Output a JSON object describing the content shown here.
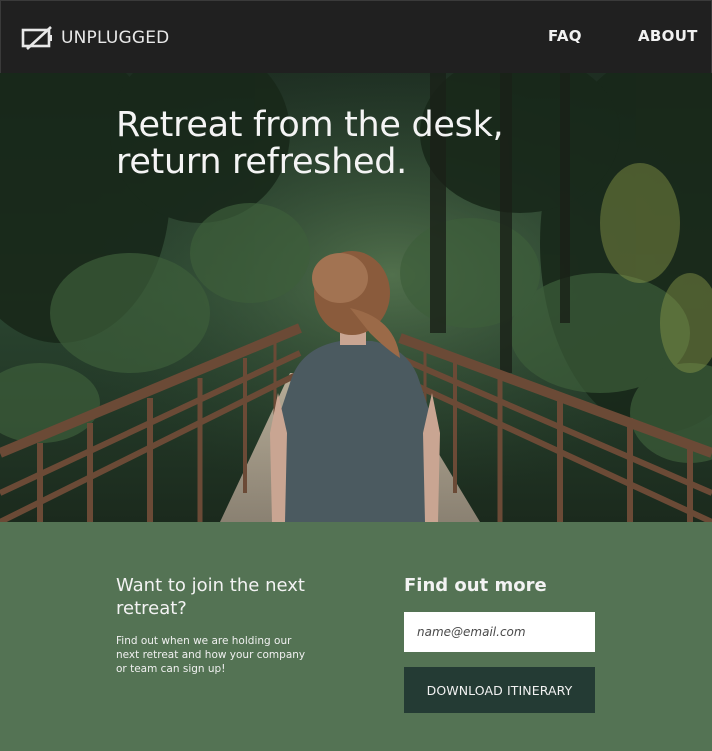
{
  "navbar": {
    "brand": "UNPLUGGED",
    "logo_icon": "battery-off-icon",
    "links": [
      {
        "label": "FAQ"
      },
      {
        "label": "ABOUT"
      }
    ]
  },
  "hero": {
    "title": "Retreat from the desk,\nreturn refreshed.",
    "image": "woman-on-forest-bridge-photo"
  },
  "signup": {
    "heading": "Want to join the next retreat?",
    "text": "Find out when we are holding our next retreat and how your company or team can sign up!",
    "more_heading": "Find out more",
    "email_placeholder": "name@email.com",
    "button_label": "DOWNLOAD ITINERARY"
  },
  "colors": {
    "navbar_bg": "#202020",
    "signup_bg": "#547354",
    "button_bg": "#243b34",
    "text_light": "#f3f3f3"
  }
}
